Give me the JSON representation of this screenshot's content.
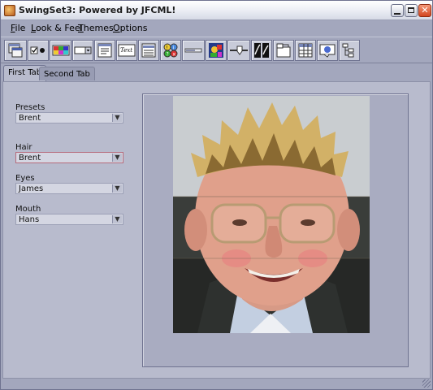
{
  "window": {
    "title": "SwingSet3: Powered by JFCML!"
  },
  "menubar": {
    "items": [
      {
        "first": "F",
        "rest": "ile"
      },
      {
        "first": "L",
        "rest": "ook & Feel"
      },
      {
        "first": "T",
        "rest": "hemes"
      },
      {
        "first": "O",
        "rest": "ptions"
      }
    ]
  },
  "toolbar": {
    "buttons": [
      "internal-frame-icon",
      "checkbox-radio-icon",
      "color-chooser-icon",
      "combobox-icon",
      "file-chooser-icon",
      "editor-pane-icon",
      "list-icon",
      "option-pane-icon",
      "progress-bar-icon",
      "scroll-pane-icon",
      "slider-icon",
      "split-pane-icon",
      "tabbed-pane-icon",
      "table-icon",
      "tooltip-icon",
      "tree-icon"
    ]
  },
  "tabs": [
    {
      "label": "First Tab",
      "active": true
    },
    {
      "label": "Second Tab",
      "active": false
    }
  ],
  "form": {
    "presets": {
      "label": "Presets",
      "value": "Brent"
    },
    "hair": {
      "label": "Hair",
      "value": "Brent"
    },
    "eyes": {
      "label": "Eyes",
      "value": "James"
    },
    "mouth": {
      "label": "Mouth",
      "value": "Hans"
    }
  },
  "colors": {
    "background": "#a3a7bd",
    "panel": "#b8bbcd",
    "selected_border": "#b66b7c"
  }
}
